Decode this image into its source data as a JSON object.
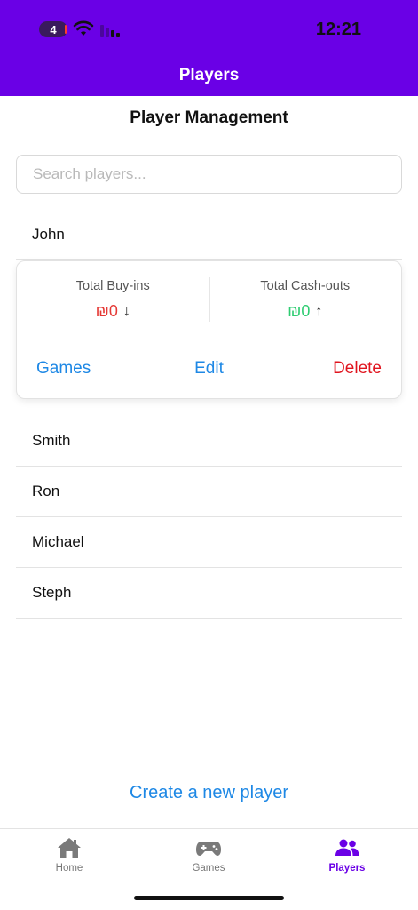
{
  "status_bar": {
    "battery": "4",
    "time": "12:21"
  },
  "header": {
    "title": "Players"
  },
  "subheader": {
    "title": "Player Management"
  },
  "search": {
    "placeholder": "Search players..."
  },
  "players": [
    "John",
    "Smith",
    "Ron",
    "Michael",
    "Steph"
  ],
  "expanded_card": {
    "buy_ins_label": "Total Buy-ins",
    "buy_ins_value": "₪0",
    "buy_ins_arrow": "↓",
    "cash_outs_label": "Total Cash-outs",
    "cash_outs_value": "₪0",
    "cash_outs_arrow": "↑",
    "games_label": "Games",
    "edit_label": "Edit",
    "delete_label": "Delete"
  },
  "create_link": "Create a new player",
  "tabs": [
    {
      "label": "Home",
      "icon": "home-icon"
    },
    {
      "label": "Games",
      "icon": "gamepad-icon"
    },
    {
      "label": "Players",
      "icon": "players-icon",
      "active": true
    }
  ],
  "colors": {
    "header": "#6a00e6",
    "link": "#1e88e5",
    "danger": "#e0141e",
    "buy_ins": "#e53935",
    "cash_outs": "#2ecc71"
  }
}
